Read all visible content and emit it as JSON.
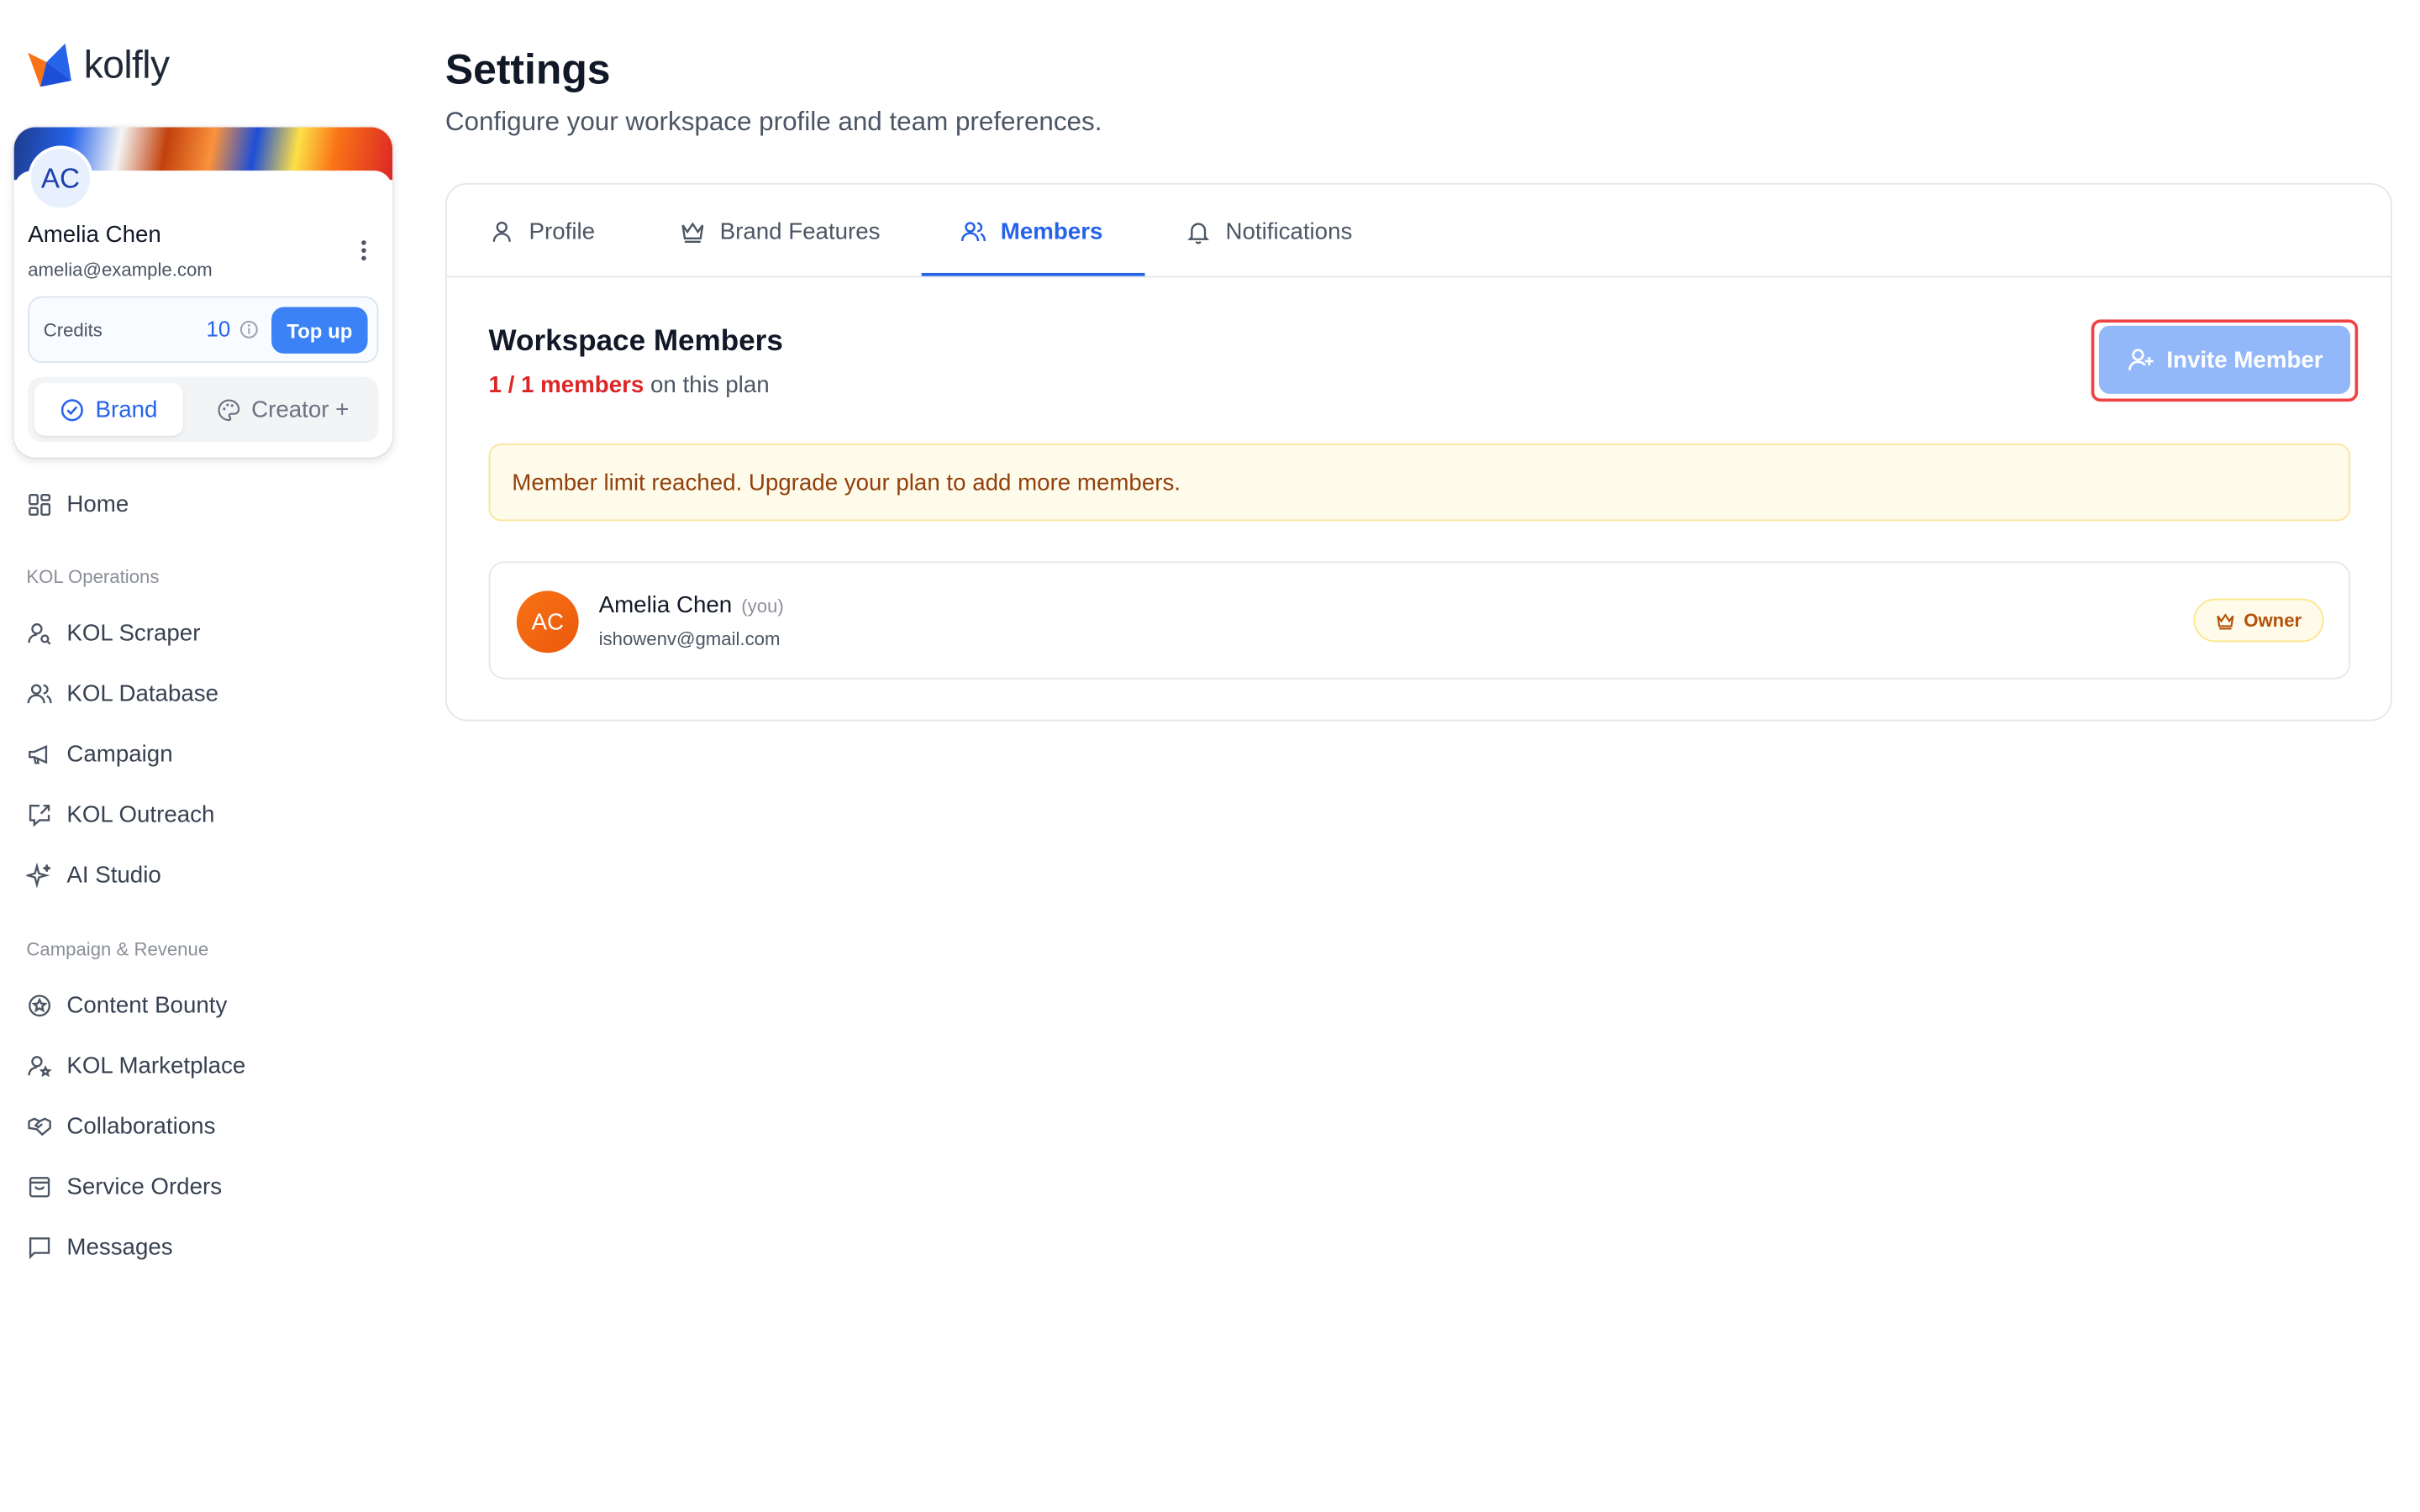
{
  "brand": {
    "logo_text": "kolfly"
  },
  "profile": {
    "initials": "AC",
    "name": "Amelia Chen",
    "email": "amelia@example.com",
    "credits_label": "Credits",
    "credits_value": "10",
    "topup_label": "Top up",
    "mode_brand": "Brand",
    "mode_creator": "Creator +"
  },
  "nav": {
    "home": "Home",
    "section_ops": "KOL Operations",
    "ops": [
      "KOL Scraper",
      "KOL Database",
      "Campaign",
      "KOL Outreach",
      "AI Studio"
    ],
    "section_rev": "Campaign & Revenue",
    "rev": [
      "Content Bounty",
      "KOL Marketplace",
      "Collaborations",
      "Service Orders",
      "Messages"
    ]
  },
  "page": {
    "title": "Settings",
    "subtitle": "Configure your workspace profile and team preferences."
  },
  "tabs": [
    "Profile",
    "Brand Features",
    "Members",
    "Notifications"
  ],
  "active_tab": "Members",
  "members": {
    "title": "Workspace Members",
    "count": "1 / 1 members",
    "count_suffix": " on this plan",
    "invite_label": "Invite Member",
    "alert": "Member limit reached. Upgrade your plan to add more members.",
    "list": [
      {
        "initials": "AC",
        "name": "Amelia Chen",
        "you": "(you)",
        "email": "ishowenv@gmail.com",
        "role": "Owner"
      }
    ]
  },
  "colors": {
    "accent": "#2563eb",
    "danger": "#dc2626",
    "warning_bg": "#fefbea",
    "owner": "#b45309"
  }
}
